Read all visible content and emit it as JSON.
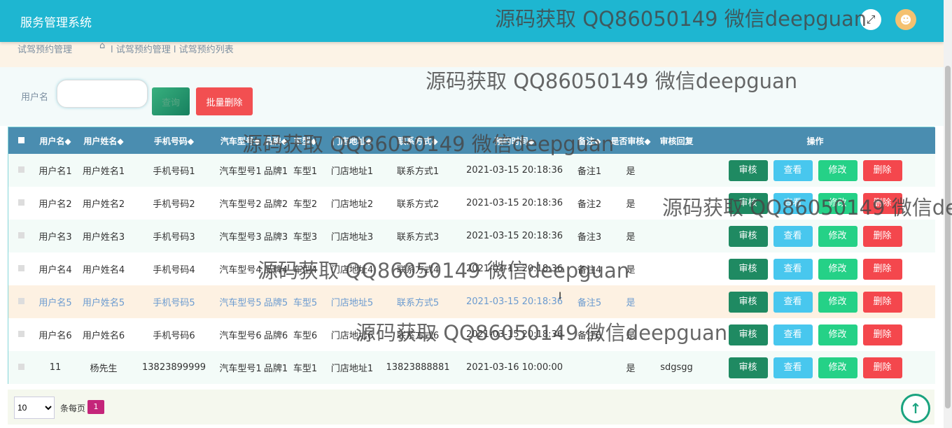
{
  "header": {
    "title": "服务管理系统"
  },
  "icons": {
    "expand": "expand-icon",
    "user": "user-avatar-icon",
    "home": "home-icon",
    "to_top": "arrow-up-icon"
  },
  "breadcrumb": {
    "title": "试驾预约管理",
    "path": "l 试驾预约管理 l 试驾预约列表"
  },
  "search": {
    "label": "用户名",
    "value": "",
    "query_button": "查询",
    "batch_delete_button": "批量删除"
  },
  "table": {
    "columns": [
      "用户名◆",
      "用户姓名◆",
      "手机号码◆",
      "汽车型号◆",
      "品牌◆",
      "车型◆",
      "门店地址◆",
      "联系方式◆",
      "预约时间◆",
      "备注◆",
      "是否审核◆",
      "审核回复",
      "操作"
    ],
    "actions": {
      "review": "审核",
      "view": "查看",
      "edit": "修改",
      "delete": "删除"
    },
    "rows": [
      [
        "用户名1",
        "用户姓名1",
        "手机号码1",
        "汽车型号1",
        "品牌1",
        "车型1",
        "门店地址1",
        "联系方式1",
        "2021-03-15 20:18:36",
        "备注1",
        "是",
        ""
      ],
      [
        "用户名2",
        "用户姓名2",
        "手机号码2",
        "汽车型号2",
        "品牌2",
        "车型2",
        "门店地址2",
        "联系方式2",
        "2021-03-15 20:18:36",
        "备注2",
        "是",
        ""
      ],
      [
        "用户名3",
        "用户姓名3",
        "手机号码3",
        "汽车型号3",
        "品牌3",
        "车型3",
        "门店地址3",
        "联系方式3",
        "2021-03-15 20:18:36",
        "备注3",
        "是",
        ""
      ],
      [
        "用户名4",
        "用户姓名4",
        "手机号码4",
        "汽车型号4",
        "品牌4",
        "车型4",
        "门店地址4",
        "联系方式4",
        "2021-03-15 20:18:36",
        "备注4",
        "是",
        ""
      ],
      [
        "用户名5",
        "用户姓名5",
        "手机号码5",
        "汽车型号5",
        "品牌5",
        "车型5",
        "门店地址5",
        "联系方式5",
        "2021-03-15 20:18:36",
        "备注5",
        "是",
        ""
      ],
      [
        "用户名6",
        "用户姓名6",
        "手机号码6",
        "汽车型号6",
        "品牌6",
        "车型6",
        "门店地址6",
        "联系方式6",
        "2021-03-15 20:18:36",
        "备注6",
        "是",
        ""
      ],
      [
        "11",
        "杨先生",
        "13823899999",
        "汽车型号1",
        "品牌1",
        "车型1",
        "门店地址1",
        "13823888881",
        "2021-03-16 10:00:00",
        "",
        "是",
        "sdgsgg"
      ]
    ]
  },
  "pagination": {
    "page_size": "10",
    "per_page_label": "条每页",
    "current_page": "1"
  },
  "watermark": "源码获取 QQ86050149 微信deepguan",
  "colors": {
    "header": "#1eb6d1",
    "table_header": "#4a8db0",
    "review": "#1f8a62",
    "view": "#48c7ee",
    "edit": "#25d187",
    "delete": "#f4474d",
    "page_active": "#c4257a"
  }
}
